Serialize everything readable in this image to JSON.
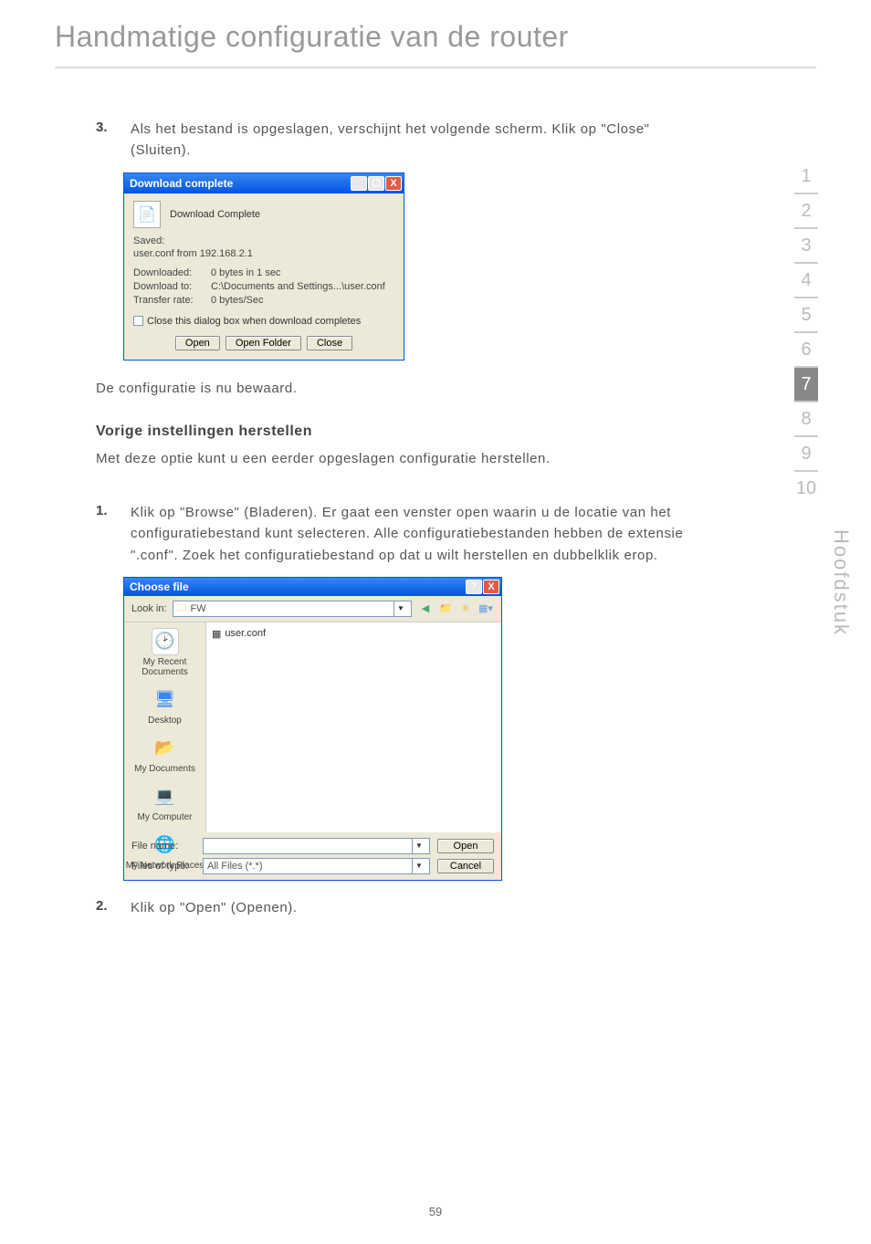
{
  "page_title": "Handmatige configuratie van de router",
  "step3": {
    "number": "3.",
    "text": "Als het bestand is opgeslagen, verschijnt het volgende scherm. Klik op \"Close\" (Sluiten)."
  },
  "download_dialog": {
    "title": "Download complete",
    "heading": "Download Complete",
    "saved_label": "Saved:",
    "saved_value": "user.conf from 192.168.2.1",
    "downloaded_label": "Downloaded:",
    "downloaded_value": "0 bytes in 1 sec",
    "downloadto_label": "Download to:",
    "downloadto_value": "C:\\Documents and Settings...\\user.conf",
    "rate_label": "Transfer rate:",
    "rate_value": "0 bytes/Sec",
    "checkbox_label": "Close this dialog box when download completes",
    "open_btn": "Open",
    "open_folder_btn": "Open Folder",
    "close_btn": "Close"
  },
  "config_saved_text": "De configuratie is nu bewaard.",
  "restore_heading": "Vorige instellingen herstellen",
  "restore_intro": "Met deze optie kunt u een eerder opgeslagen configuratie herstellen.",
  "step1": {
    "number": "1.",
    "text": "Klik op \"Browse\" (Bladeren). Er gaat een venster open waarin u de locatie van het configuratiebestand kunt selecteren. Alle configuratiebestanden hebben de extensie \".conf\". Zoek het configuratiebestand op dat u wilt herstellen en dubbelklik erop."
  },
  "file_dialog": {
    "title": "Choose file",
    "lookin_label": "Look in:",
    "lookin_value": "FW",
    "file_in_pane": "user.conf",
    "places": {
      "recent": "My Recent Documents",
      "desktop": "Desktop",
      "mydocs": "My Documents",
      "mycomp": "My Computer",
      "mynet": "My Network Places"
    },
    "filename_label": "File name:",
    "filename_value": "",
    "filetype_label": "Files of type:",
    "filetype_value": "All Files (*.*)",
    "open_btn": "Open",
    "cancel_btn": "Cancel",
    "help_btn": "?",
    "close_btn": "X"
  },
  "step2": {
    "number": "2.",
    "text": "Klik op \"Open\" (Openen)."
  },
  "side_tabs": [
    "1",
    "2",
    "3",
    "4",
    "5",
    "6",
    "7",
    "8",
    "9",
    "10"
  ],
  "side_label": "Hoofdstuk",
  "page_number": "59"
}
